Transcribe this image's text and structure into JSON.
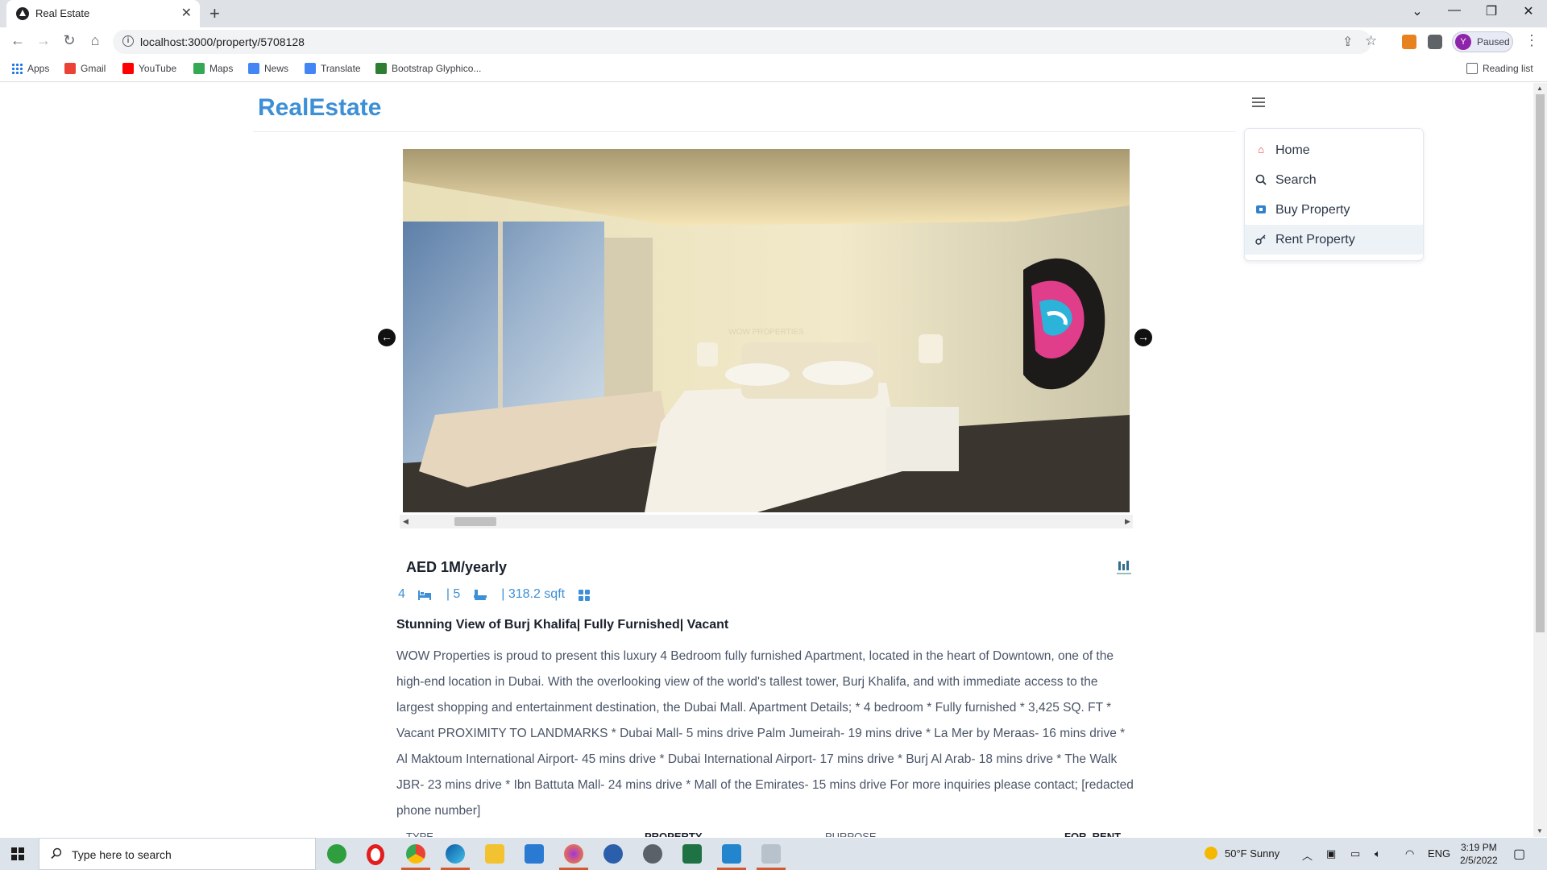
{
  "browser": {
    "tab_title": "Real Estate",
    "tab_close": "✕",
    "new_tab": "+",
    "url": "localhost:3000/property/5708128",
    "profile_initial": "Y",
    "profile_status": "Paused",
    "window_controls": {
      "minimize": "—",
      "restore": "❐",
      "close": "✕",
      "tabsearch": "⌄"
    }
  },
  "bookmarks": [
    {
      "label": "Apps",
      "icon": "apps-grid-icon"
    },
    {
      "label": "Gmail",
      "icon": "gmail-icon",
      "color": "#ea4335"
    },
    {
      "label": "YouTube",
      "icon": "youtube-icon",
      "color": "#ff0000"
    },
    {
      "label": "Maps",
      "icon": "maps-icon",
      "color": "#34a853"
    },
    {
      "label": "News",
      "icon": "news-icon",
      "color": "#4285f4"
    },
    {
      "label": "Translate",
      "icon": "translate-icon",
      "color": "#4285f4"
    },
    {
      "label": "Bootstrap Glyphico...",
      "icon": "bootstrap-icon",
      "color": "#2e7d32"
    }
  ],
  "reading_list": "Reading list",
  "site": {
    "brand": "RealEstate",
    "brand_color": "#3d8fd6",
    "menu": [
      {
        "label": "Home",
        "icon": "home-icon",
        "color": "#e53e3e"
      },
      {
        "label": "Search",
        "icon": "search-icon",
        "color": "#2d3748"
      },
      {
        "label": "Buy Property",
        "icon": "buy-property-icon",
        "color": "#3182ce"
      },
      {
        "label": "Rent Property",
        "icon": "key-icon",
        "color": "#2d3748"
      }
    ]
  },
  "property": {
    "price": "AED 1M/yearly",
    "rooms": "4",
    "baths": "| 5",
    "area": "| 318.2 sqft",
    "title": "Stunning View of Burj Khalifa| Fully Furnished| Vacant",
    "description": "WOW Properties is proud to present this luxury 4 Bedroom fully furnished Apartment, located in the heart of Downtown, one of the high-end location in Dubai. With the overlooking view of the world's tallest tower, Burj Khalifa, and with immediate access to the largest shopping and entertainment destination, the Dubai Mall. Apartment Details; * 4 bedroom * Fully furnished * 3,425 SQ. FT * Vacant PROXIMITY TO LANDMARKS * Dubai Mall- 5 mins drive Palm Jumeirah- 19 mins drive * La Mer by Meraas- 16 mins drive * Al Maktoum International Airport- 45 mins drive * Dubai International Airport- 17 mins drive * Burj Al Arab- 18 mins drive * The Walk JBR- 23 mins drive * Ibn Battuta Mall- 24 mins drive * Mall of the Emirates- 15 mins drive For more inquiries please contact; [redacted phone number]",
    "info": {
      "type_label": "TYPE",
      "type_value": "PROPERTY",
      "purpose_label": "PURPOSE",
      "purpose_value": "FOR_RENT"
    },
    "watermark": "WOW PROPERTIES"
  },
  "taskbar": {
    "search_placeholder": "Type here to search",
    "weather": "50°F  Sunny",
    "language": "ENG",
    "time": "3:19 PM",
    "date": "2/5/2022"
  }
}
